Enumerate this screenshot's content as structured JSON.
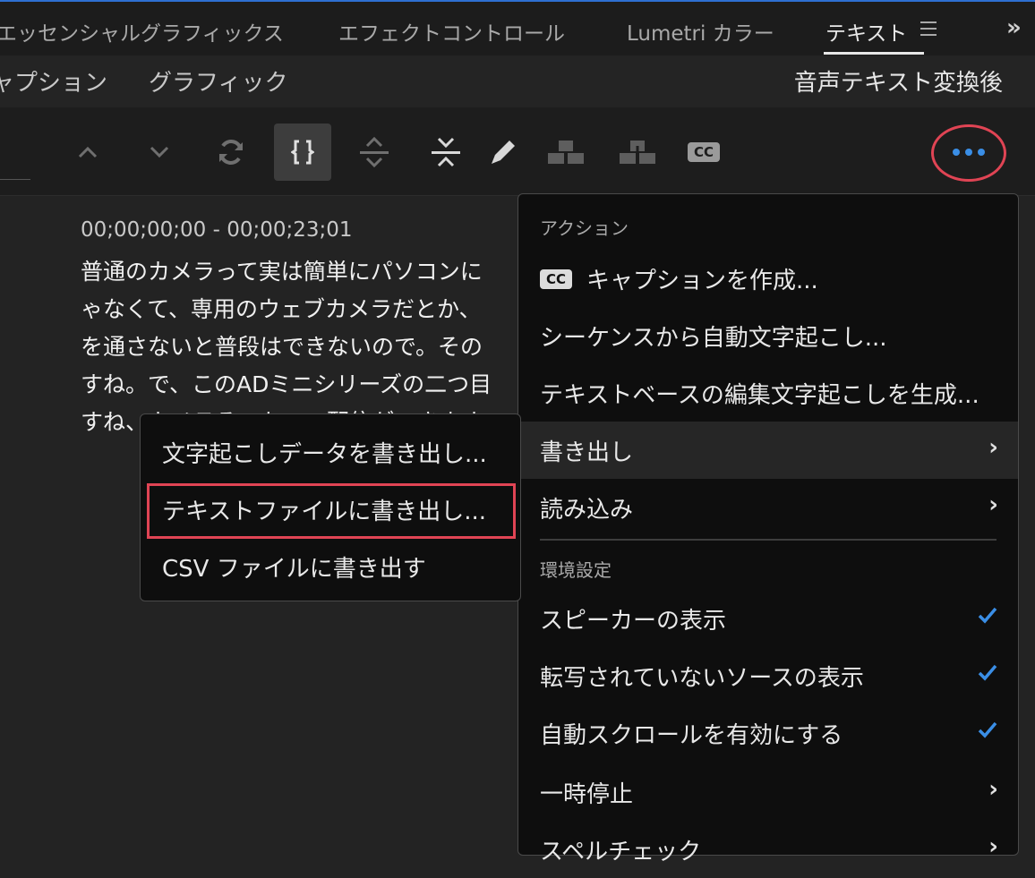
{
  "panel_tabs": [
    {
      "label": "エッセンシャルグラフィックス",
      "active": false
    },
    {
      "label": "エフェクトコントロール",
      "active": false
    },
    {
      "label": "Lumetri カラー",
      "active": false
    },
    {
      "label": "テキスト",
      "active": true
    }
  ],
  "panel_overflow": "»",
  "sub_tabs": [
    "キャプション",
    "グラフィック"
  ],
  "sequence_title": "音声テキスト変換後",
  "toolbar": {
    "icons": [
      "chevron-up-icon",
      "chevron-down-icon",
      "refresh-icon",
      "split-segment-icon",
      "expand-icon",
      "collapse-icon",
      "pencil-icon",
      "merge-speaker-icon",
      "split-speaker-icon",
      "cc-icon"
    ],
    "cc_label": "CC",
    "accent": "#3a8ee6",
    "highlight": "#e04454"
  },
  "transcript": {
    "timecode": "00;00;00;00 - 00;00;23;01",
    "lines": [
      "普通のカメラって実は簡単にパソコンに",
      "ゃなくて、専用のウェブカメラだとか、",
      "を通さないと普段はできないので。その",
      "すね。で、このADミニシリーズの二つ目",
      "すね、カメラそのもので配信ができます"
    ]
  },
  "main_menu": {
    "actions_header": "アクション",
    "cc_badge": "CC",
    "items": [
      {
        "label": "キャプションを作成..."
      },
      {
        "label": "シーケンスから自動文字起こし..."
      },
      {
        "label": "テキストベースの編集文字起こしを生成..."
      },
      {
        "label": "書き出し"
      },
      {
        "label": "読み込み"
      }
    ],
    "prefs_header": "環境設定",
    "pref_items": [
      {
        "label": "スピーカーの表示"
      },
      {
        "label": "転写されていないソースの表示"
      },
      {
        "label": "自動スクロールを有効にする"
      },
      {
        "label": "一時停止"
      },
      {
        "label": "スペルチェック"
      }
    ],
    "arrow": "›"
  },
  "export_submenu": {
    "items": [
      {
        "label": "文字起こしデータを書き出し..."
      },
      {
        "label": "テキストファイルに書き出し..."
      },
      {
        "label": "CSV ファイルに書き出す"
      }
    ]
  }
}
